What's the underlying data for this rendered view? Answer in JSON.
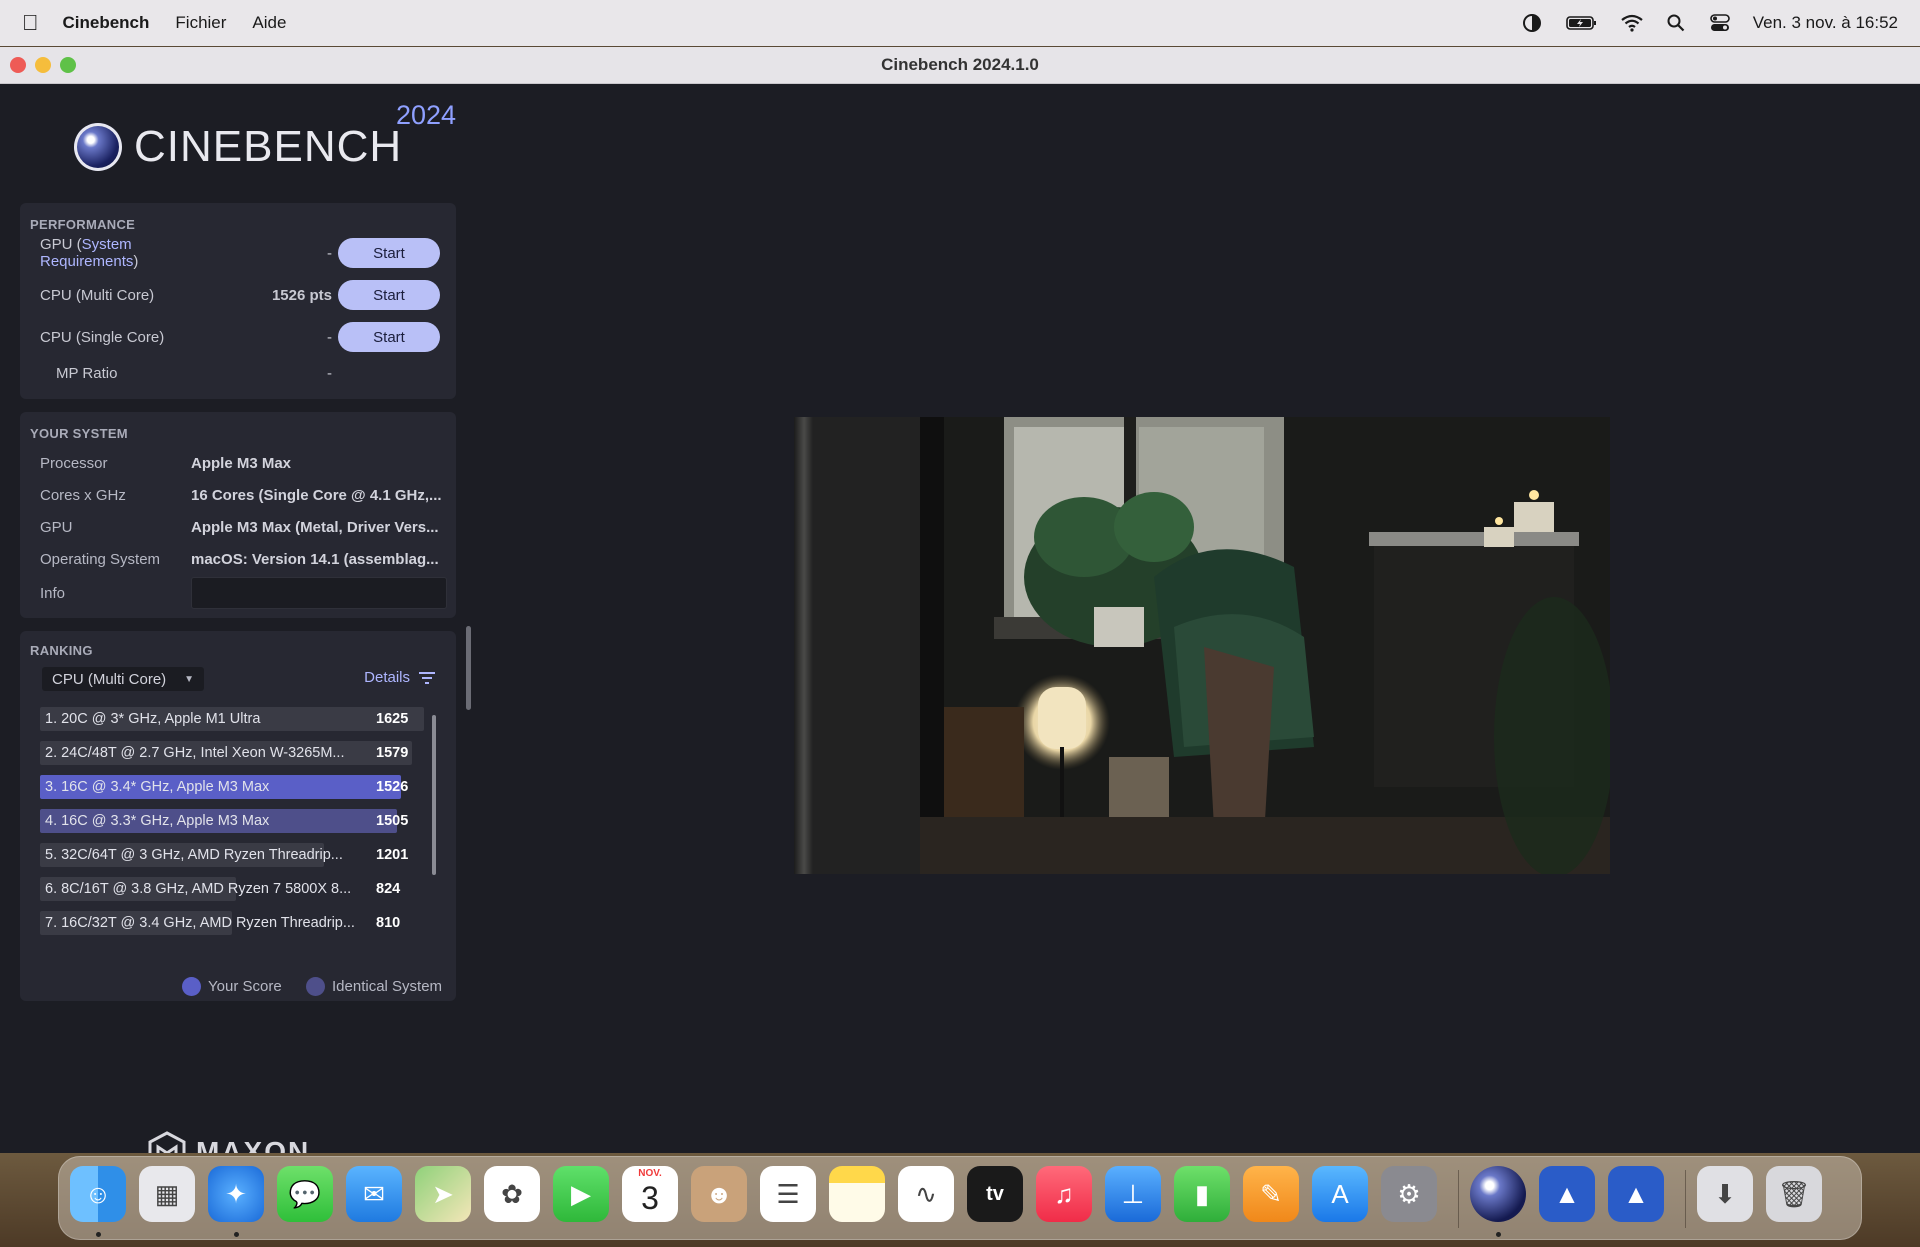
{
  "menubar": {
    "app_name": "Cinebench",
    "items": [
      "Fichier",
      "Aide"
    ],
    "clock": "Ven. 3 nov. à 16:52"
  },
  "window": {
    "title": "Cinebench 2024.1.0"
  },
  "logo": {
    "name": "CINEBENCH",
    "year": "2024"
  },
  "performance": {
    "title": "PERFORMANCE",
    "rows": [
      {
        "label_prefix": "GPU (",
        "label_link": "System Requirements",
        "label_suffix": ")",
        "value": "-",
        "button": "Start"
      },
      {
        "label": "CPU (Multi Core)",
        "value": "1526 pts",
        "button": "Start"
      },
      {
        "label": "CPU (Single Core)",
        "value": "-",
        "button": "Start"
      },
      {
        "label": "MP Ratio",
        "value": "-"
      }
    ]
  },
  "system": {
    "title": "YOUR SYSTEM",
    "rows": [
      {
        "key": "Processor",
        "value": "Apple M3 Max"
      },
      {
        "key": "Cores x GHz",
        "value": "16 Cores (Single Core @ 4.1 GHz,..."
      },
      {
        "key": "GPU",
        "value": "Apple M3 Max (Metal, Driver Vers..."
      },
      {
        "key": "Operating System",
        "value": "macOS: Version 14.1 (assemblag..."
      },
      {
        "key": "Info",
        "value": ""
      }
    ]
  },
  "ranking": {
    "title": "RANKING",
    "selected": "CPU (Multi Core)",
    "details_label": "Details",
    "items": [
      {
        "label": "1. 20C @ 3* GHz, Apple M1 Ultra",
        "score": "1625",
        "fraction": 1.0,
        "highlight": false
      },
      {
        "label": "2. 24C/48T @ 2.7 GHz, Intel Xeon W-3265M...",
        "score": "1579",
        "fraction": 0.97,
        "highlight": false
      },
      {
        "label": "3. 16C @ 3.4* GHz, Apple M3 Max",
        "score": "1526",
        "fraction": 0.94,
        "highlight": "yours"
      },
      {
        "label": "4. 16C @ 3.3* GHz, Apple M3 Max",
        "score": "1505",
        "fraction": 0.93,
        "highlight": "identical"
      },
      {
        "label": "5. 32C/64T @ 3 GHz, AMD Ryzen Threadrip...",
        "score": "1201",
        "fraction": 0.74,
        "highlight": false
      },
      {
        "label": "6. 8C/16T @ 3.8 GHz, AMD Ryzen 7 5800X 8...",
        "score": "824",
        "fraction": 0.51,
        "highlight": false
      },
      {
        "label": "7. 16C/32T @ 3.4 GHz, AMD Ryzen Threadrip...",
        "score": "810",
        "fraction": 0.5,
        "highlight": false
      }
    ],
    "legend": {
      "your_score": "Your Score",
      "identical_system": "Identical System"
    }
  },
  "brand": "MAXON",
  "colors": {
    "accent": "#b9c0f7",
    "your_score": "#5a5fc7",
    "identical_system": "#4e4f8a",
    "bar": "#3a3b45"
  },
  "calendar": {
    "month": "NOV.",
    "day": "3"
  },
  "dock": [
    {
      "name": "finder-icon"
    },
    {
      "name": "launchpad-icon"
    },
    {
      "name": "safari-icon"
    },
    {
      "name": "messages-icon"
    },
    {
      "name": "mail-icon"
    },
    {
      "name": "maps-icon"
    },
    {
      "name": "photos-icon"
    },
    {
      "name": "facetime-icon"
    },
    {
      "name": "calendar-icon"
    },
    {
      "name": "contacts-icon"
    },
    {
      "name": "reminders-icon"
    },
    {
      "name": "notes-icon"
    },
    {
      "name": "freeform-icon"
    },
    {
      "name": "apple-tv-icon"
    },
    {
      "name": "music-icon"
    },
    {
      "name": "keynote-icon"
    },
    {
      "name": "numbers-icon"
    },
    {
      "name": "pages-icon"
    },
    {
      "name": "app-store-icon"
    },
    {
      "name": "system-settings-icon"
    },
    {
      "name": "cinebench-icon"
    },
    {
      "name": "activity-monitor-icon"
    },
    {
      "name": "activity-monitor-2-icon"
    },
    {
      "name": "downloads-icon"
    },
    {
      "name": "trash-icon"
    }
  ]
}
